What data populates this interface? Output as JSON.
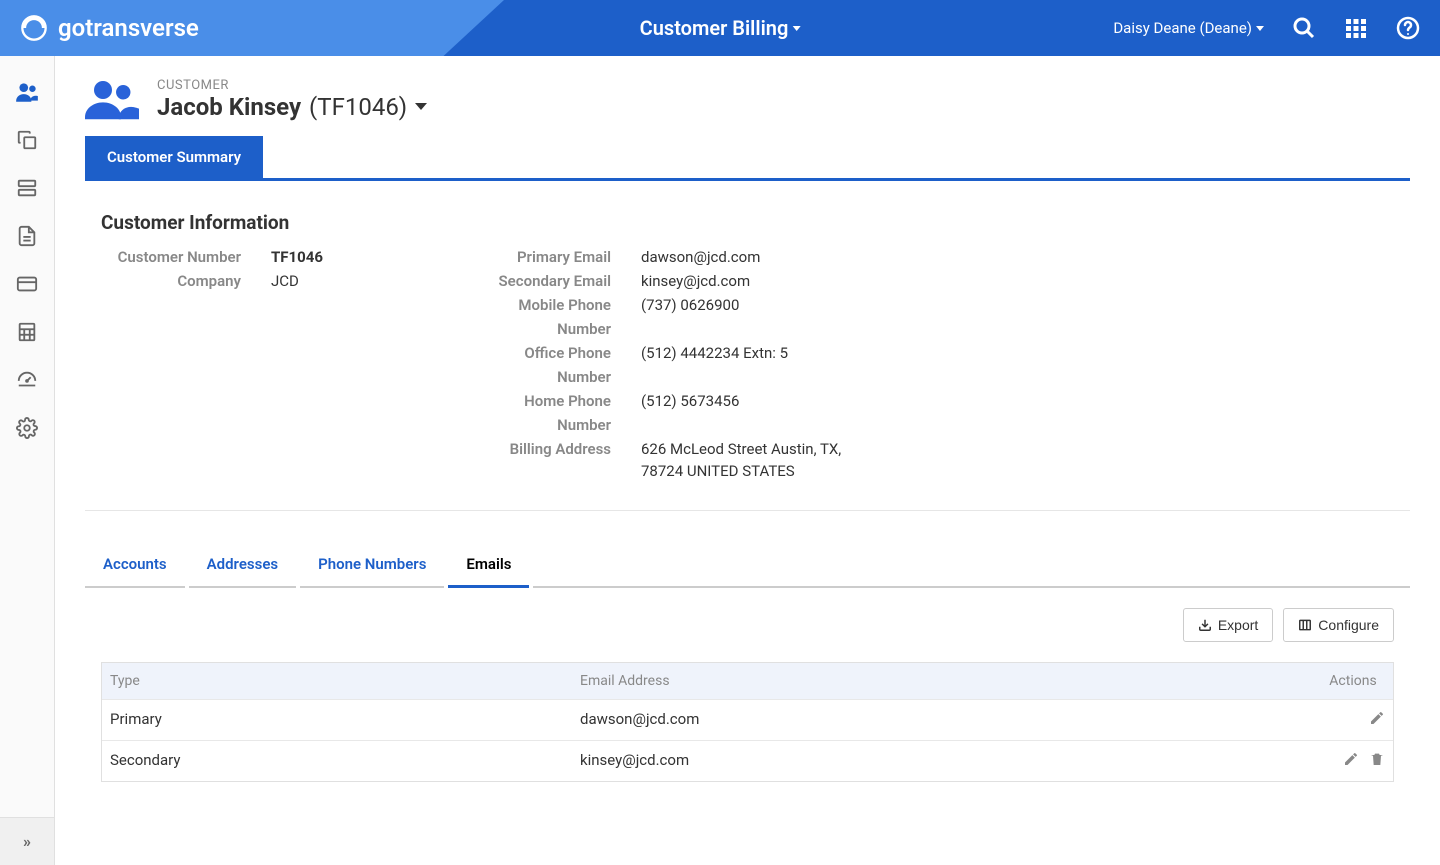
{
  "header": {
    "brand": "gotransverse",
    "center_title": "Customer Billing",
    "user": "Daisy Deane (Deane)"
  },
  "page": {
    "label": "CUSTOMER",
    "title_name": "Jacob Kinsey",
    "title_num": "(TF1046)"
  },
  "top_tab": "Customer Summary",
  "section_title": "Customer Information",
  "info_left": {
    "customer_number_label": "Customer Number",
    "customer_number_value": "TF1046",
    "company_label": "Company",
    "company_value": "JCD"
  },
  "info_right": {
    "primary_email_label": "Primary Email",
    "primary_email_value": "dawson@jcd.com",
    "secondary_email_label": "Secondary Email",
    "secondary_email_value": "kinsey@jcd.com",
    "mobile_label_1": "Mobile Phone",
    "mobile_label_2": "Number",
    "mobile_value": "(737) 0626900",
    "office_label_1": "Office Phone",
    "office_label_2": "Number",
    "office_value": "(512) 4442234 Extn: 5",
    "home_label_1": "Home Phone",
    "home_label_2": "Number",
    "home_value": "(512) 5673456",
    "billing_label": "Billing Address",
    "billing_value": "626 McLeod Street Austin, TX, 78724 UNITED STATES"
  },
  "sub_tabs": {
    "accounts": "Accounts",
    "addresses": "Addresses",
    "phone": "Phone Numbers",
    "emails": "Emails"
  },
  "buttons": {
    "export": "Export",
    "configure": "Configure"
  },
  "table": {
    "headers": {
      "type": "Type",
      "email": "Email Address",
      "actions": "Actions"
    },
    "rows": [
      {
        "type": "Primary",
        "email": "dawson@jcd.com",
        "canDelete": false
      },
      {
        "type": "Secondary",
        "email": "kinsey@jcd.com",
        "canDelete": true
      }
    ]
  }
}
